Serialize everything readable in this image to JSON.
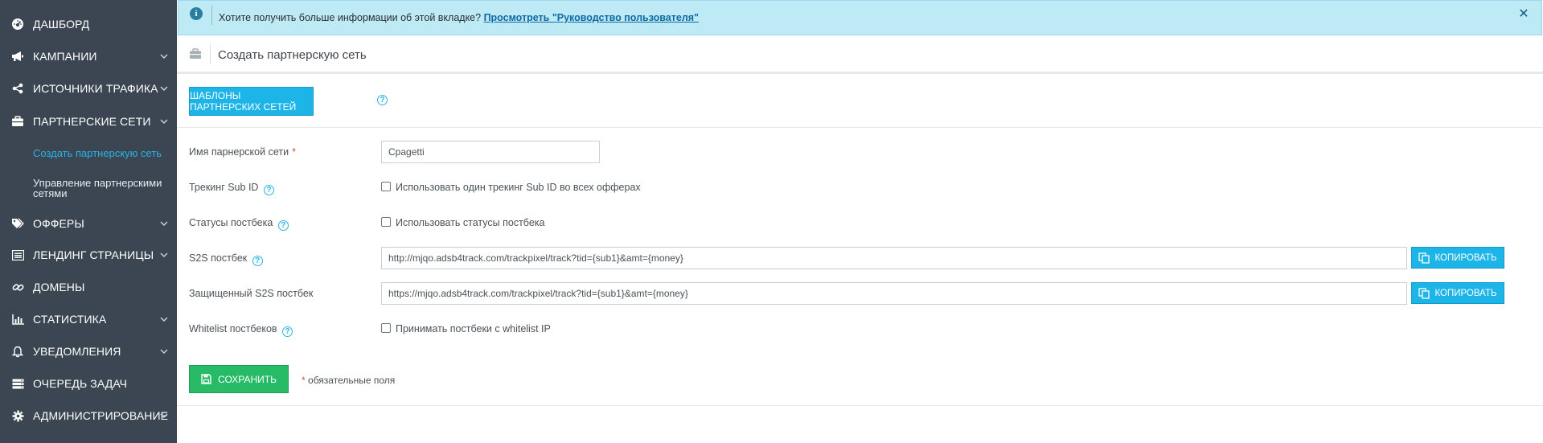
{
  "sidebar": {
    "items": [
      {
        "label": "ДАШБОРД",
        "icon": "dashboard-icon"
      },
      {
        "label": "КАМПАНИИ",
        "icon": "megaphone-icon"
      },
      {
        "label": "ИСТОЧНИКИ ТРАФИКА",
        "icon": "share-icon"
      },
      {
        "label": "ПАРТНЕРСКИЕ СЕТИ",
        "icon": "briefcase-icon"
      },
      {
        "label": "ОФФЕРЫ",
        "icon": "tags-icon"
      },
      {
        "label": "ЛЕНДИНГ СТРАНИЦЫ",
        "icon": "list-icon"
      },
      {
        "label": "ДОМЕНЫ",
        "icon": "link-icon"
      },
      {
        "label": "СТАТИСТИКА",
        "icon": "bar-chart-icon"
      },
      {
        "label": "УВЕДОМЛЕНИЯ",
        "icon": "bell-icon"
      },
      {
        "label": "ОЧЕРЕДЬ ЗАДАЧ",
        "icon": "server-icon"
      },
      {
        "label": "АДМИНИСТРИРОВАНИЕ",
        "icon": "gear-icon"
      }
    ],
    "sub_items": [
      {
        "label": "Создать партнерскую сеть"
      },
      {
        "label_line1": "Управление партнерскими",
        "label_line2": "сетями"
      }
    ]
  },
  "alert": {
    "text": "Хотите получить больше информации об этой вкладке? ",
    "link": "Просмотреть \"Руководство пользователя\""
  },
  "page": {
    "title": "Создать партнерскую сеть",
    "templates_button": "ШАБЛОНЫ ПАРТНЕРСКИХ СЕТЕЙ"
  },
  "form": {
    "name_label": "Имя парнерской сети",
    "required_mark": "*",
    "name_value": "Cpagetti",
    "subid_label": "Трекинг Sub ID",
    "subid_checkbox": "Использовать один трекинг Sub ID во всех офферах",
    "statuses_label": "Статусы постбека",
    "statuses_checkbox": "Использовать статусы постбека",
    "s2s_label": "S2S постбек",
    "s2s_value": "http://mjqo.adsb4track.com/trackpixel/track?tid={sub1}&amt={money}",
    "secure_s2s_label": "Защищенный S2S постбек",
    "secure_s2s_value": "https://mjqo.adsb4track.com/trackpixel/track?tid={sub1}&amt={money}",
    "copy_label": "КОПИРОВАТЬ",
    "whitelist_label": "Whitelist постбеков",
    "whitelist_checkbox": "Принимать постбеки с whitelist IP",
    "save_label": "СОХРАНИТЬ",
    "required_note": "обязательные поля"
  }
}
